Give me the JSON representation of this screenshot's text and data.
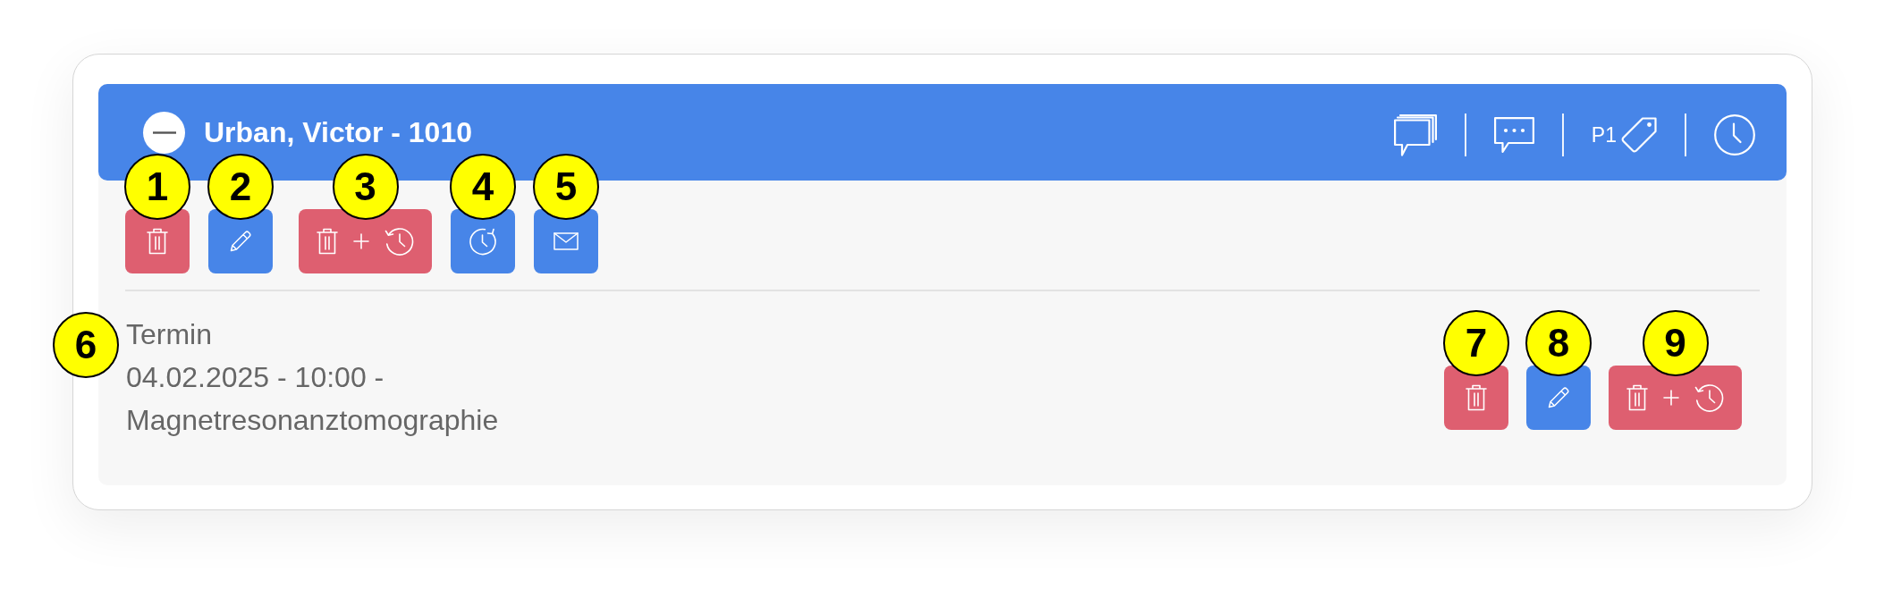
{
  "record": {
    "expanded": true,
    "title": "Urban, Victor - 1010",
    "toolbar": [
      {
        "kind": "comments"
      },
      {
        "kind": "chat"
      },
      {
        "kind": "priority",
        "label": "P1"
      },
      {
        "kind": "clock"
      }
    ],
    "actions": [
      {
        "kind": "delete",
        "marker": "1"
      },
      {
        "kind": "edit",
        "marker": "2"
      },
      {
        "kind": "delete-history",
        "marker": "3"
      },
      {
        "kind": "reschedule",
        "marker": "4"
      },
      {
        "kind": "email",
        "marker": "5"
      }
    ]
  },
  "appointment": {
    "marker": "6",
    "type": "Termin",
    "when": "04.02.2025 - 10:00 -",
    "procedure": "Magnetresonanztomographie",
    "actions": [
      {
        "kind": "delete",
        "marker": "7"
      },
      {
        "kind": "edit",
        "marker": "8"
      },
      {
        "kind": "delete-history",
        "marker": "9"
      }
    ]
  }
}
